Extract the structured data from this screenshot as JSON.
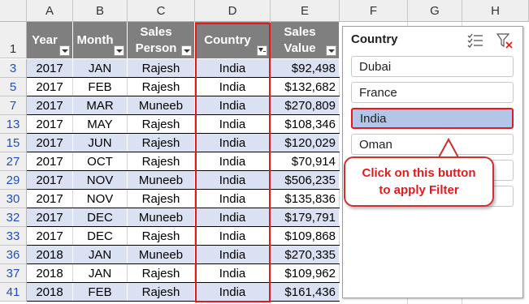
{
  "column_headers": [
    "A",
    "B",
    "C",
    "D",
    "E",
    "F",
    "G",
    "H"
  ],
  "table": {
    "headers": [
      {
        "label": "Year"
      },
      {
        "label": "Month"
      },
      {
        "label": "Sales Person"
      },
      {
        "label": "Country",
        "filtered": true
      },
      {
        "label": "Sales Value"
      }
    ],
    "header_row_number": "1",
    "rows": [
      {
        "row": "3",
        "year": "2017",
        "month": "JAN",
        "person": "Rajesh",
        "country": "India",
        "value": "$92,498"
      },
      {
        "row": "5",
        "year": "2017",
        "month": "FEB",
        "person": "Rajesh",
        "country": "India",
        "value": "$132,682"
      },
      {
        "row": "7",
        "year": "2017",
        "month": "MAR",
        "person": "Muneeb",
        "country": "India",
        "value": "$270,809"
      },
      {
        "row": "13",
        "year": "2017",
        "month": "MAY",
        "person": "Rajesh",
        "country": "India",
        "value": "$108,346"
      },
      {
        "row": "15",
        "year": "2017",
        "month": "JUN",
        "person": "Rajesh",
        "country": "India",
        "value": "$120,029"
      },
      {
        "row": "27",
        "year": "2017",
        "month": "OCT",
        "person": "Rajesh",
        "country": "India",
        "value": "$70,914"
      },
      {
        "row": "29",
        "year": "2017",
        "month": "NOV",
        "person": "Muneeb",
        "country": "India",
        "value": "$506,235"
      },
      {
        "row": "30",
        "year": "2017",
        "month": "NOV",
        "person": "Rajesh",
        "country": "India",
        "value": "$135,836"
      },
      {
        "row": "32",
        "year": "2017",
        "month": "DEC",
        "person": "Muneeb",
        "country": "India",
        "value": "$179,791"
      },
      {
        "row": "33",
        "year": "2017",
        "month": "DEC",
        "person": "Rajesh",
        "country": "India",
        "value": "$109,868"
      },
      {
        "row": "36",
        "year": "2018",
        "month": "JAN",
        "person": "Muneeb",
        "country": "India",
        "value": "$270,335"
      },
      {
        "row": "37",
        "year": "2018",
        "month": "JAN",
        "person": "Rajesh",
        "country": "India",
        "value": "$109,962"
      },
      {
        "row": "41",
        "year": "2018",
        "month": "FEB",
        "person": "Rajesh",
        "country": "India",
        "value": "$161,436"
      }
    ]
  },
  "slicer": {
    "title": "Country",
    "items": [
      {
        "label": "Dubai",
        "selected": false
      },
      {
        "label": "France",
        "selected": false
      },
      {
        "label": "India",
        "selected": true
      },
      {
        "label": "Oman",
        "selected": false
      },
      {
        "label": "",
        "selected": false
      },
      {
        "label": "",
        "selected": false
      }
    ],
    "multiselect_icon": "multi-select-icon",
    "clear_icon": "clear-filter-icon"
  },
  "callout": {
    "line1": "Click on this button",
    "line2": "to apply Filter"
  },
  "colors": {
    "accent_red": "#e11b1b",
    "band": "#d9e1f2",
    "header_bg": "#7f7f7f",
    "slicer_selected": "#b4c6e7"
  }
}
